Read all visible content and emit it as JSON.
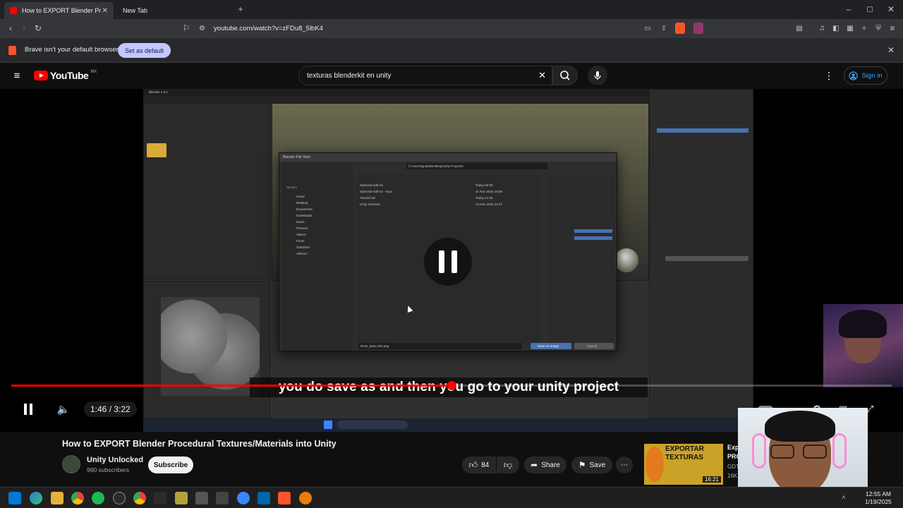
{
  "browser": {
    "tabs": [
      {
        "label": "How to EXPORT Blender Proc",
        "active": true
      },
      {
        "label": "New Tab",
        "active": false
      }
    ],
    "url": "youtube.com/watch?v=zFDu8_5lbK4",
    "infobar": {
      "message": "Brave isn't your default browser",
      "button": "Set as default"
    }
  },
  "youtube": {
    "logo": "YouTube",
    "country": "MX",
    "search_value": "texturas blenderkit en unity",
    "sign_in": "Sign in"
  },
  "player": {
    "caption": "you do save as and then you go to your unity project",
    "time": "1:46 / 3:22",
    "progress_fraction": 0.5,
    "state": "paused"
  },
  "blender": {
    "title": "Blender 4.3.1",
    "file_view_title": "Blender File View",
    "path": "C:\\Users\\gusta\\Desktop\\Unity Projects\\",
    "folders": [
      {
        "name": "Spitzoria-42b-v2",
        "date": "Today 00:00"
      },
      {
        "name": "Spitzoria-42b-v2 - Kopi",
        "date": "21 Nov 2024 16:05"
      },
      {
        "name": "Tutorial 3D",
        "date": "Today 21:36"
      },
      {
        "name": "Unity Versions",
        "date": "13 Nov 2024 21:47"
      }
    ],
    "system_items": [
      "Home",
      "Desktop",
      "Documents",
      "Downloads",
      "Music",
      "Pictures",
      "Videos",
      "Fonts",
      "OneDrive",
      "Videoer"
    ],
    "filename": "Rock_Base.001.png",
    "save_button": "Save As Image",
    "cancel_button": "Cancel"
  },
  "video_info": {
    "title": "How to EXPORT Blender Procedural Textures/Materials into Unity",
    "channel": "Unity Unlocked",
    "subscribers": "990 subscribers",
    "subscribe": "Subscribe",
    "likes": "84",
    "share": "Share",
    "save": "Save"
  },
  "recommended": {
    "thumb_text": "EXPORTAR TEXTURAS",
    "duration": "16:21",
    "title_partial": "Exportar",
    "subtitle_partial": "PROCED",
    "channel_partial": "GDT Soluti",
    "views_partial": "16K vi"
  },
  "taskbar": {
    "time": "12:55 AM",
    "date": "1/19/2025"
  },
  "colors": {
    "accent_red": "#ff0000",
    "link_blue": "#3ea6ff",
    "set_default_bg": "#c2c7ff"
  }
}
